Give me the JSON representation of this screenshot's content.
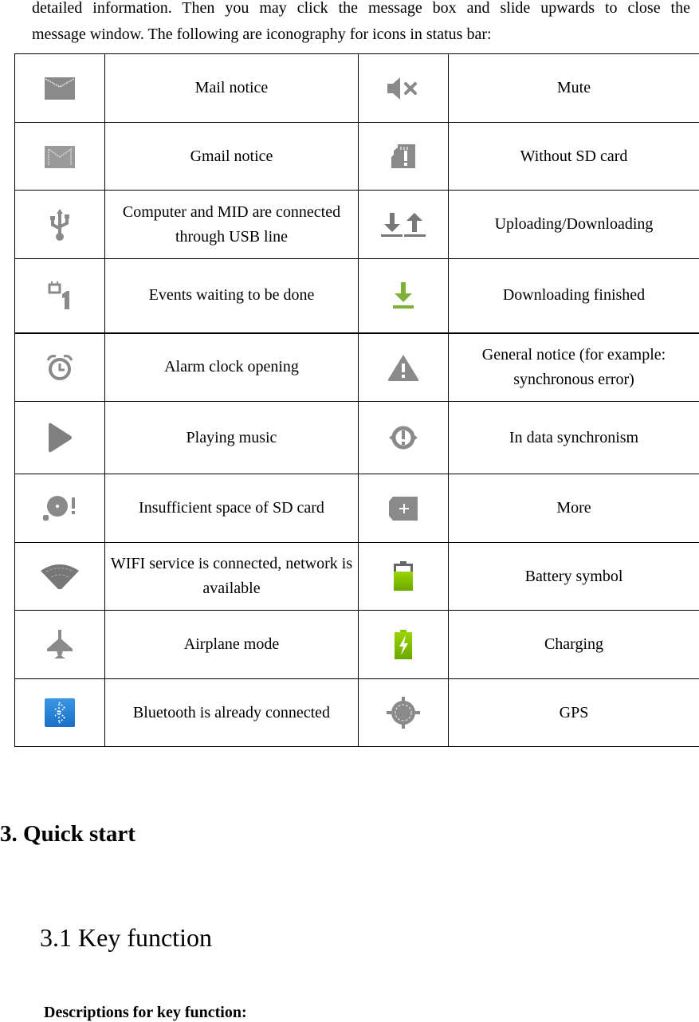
{
  "intro": {
    "line1": "detailed information. Then you may click the message box and slide upwards to close the",
    "line2": "message window. The following are iconography for icons in status bar:"
  },
  "icon_table": {
    "rows": [
      {
        "left": {
          "icon": "mail-icon",
          "label": "Mail notice"
        },
        "right": {
          "icon": "mute-icon",
          "label": "Mute"
        }
      },
      {
        "left": {
          "icon": "gmail-icon",
          "label": "Gmail notice"
        },
        "right": {
          "icon": "no-sd-card-icon",
          "label": "Without SD card"
        }
      },
      {
        "left": {
          "icon": "usb-icon",
          "label": "Computer and MID are connected through USB line"
        },
        "right": {
          "icon": "upload-download-icon",
          "label": "Uploading/Downloading"
        }
      },
      {
        "left": {
          "icon": "calendar-event-icon",
          "label": "Events waiting to be done"
        },
        "right": {
          "icon": "download-finished-icon",
          "label": "Downloading finished"
        }
      },
      {
        "left": {
          "icon": "alarm-clock-icon",
          "label": "Alarm clock opening"
        },
        "right": {
          "icon": "warning-icon",
          "label": "General notice (for example: synchronous error)"
        }
      },
      {
        "left": {
          "icon": "play-icon",
          "label": "Playing music"
        },
        "right": {
          "icon": "sync-error-icon",
          "label": "In data synchronism"
        }
      },
      {
        "left": {
          "icon": "sd-card-full-icon",
          "label": "Insufficient space of SD card"
        },
        "right": {
          "icon": "more-icon",
          "label": "More"
        }
      },
      {
        "left": {
          "icon": "wifi-icon",
          "label": "WIFI service is connected, network is available"
        },
        "right": {
          "icon": "battery-icon",
          "label": "Battery symbol"
        }
      },
      {
        "left": {
          "icon": "airplane-icon",
          "label": "Airplane mode"
        },
        "right": {
          "icon": "charging-icon",
          "label": "Charging"
        }
      },
      {
        "left": {
          "icon": "bluetooth-icon",
          "label": "Bluetooth is already connected"
        },
        "right": {
          "icon": "gps-icon",
          "label": "GPS"
        }
      }
    ]
  },
  "colors": {
    "icon_gray": "#8a8a8a",
    "icon_green": "#7fb03a",
    "battery_green": "#8cc400",
    "bluetooth_blue": "#2a86d8"
  },
  "section": {
    "heading": "3. Quick start",
    "subheading": "3.1 Key function",
    "description_label": "Descriptions for key function:"
  }
}
